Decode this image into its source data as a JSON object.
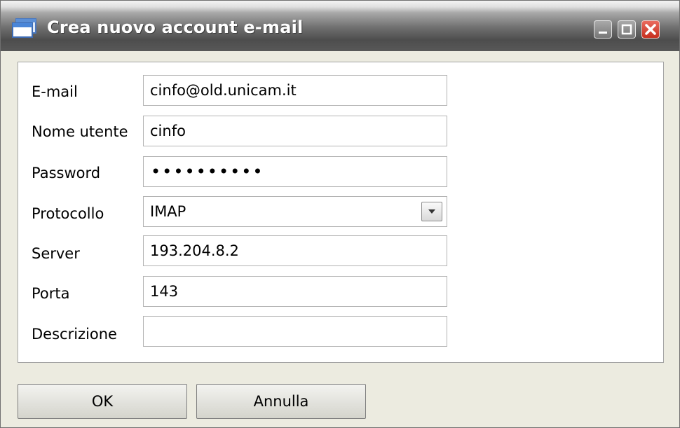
{
  "window": {
    "title": "Crea nuovo account e-mail",
    "controls": {
      "minimize_icon": "minimize-icon",
      "maximize_icon": "maximize-icon",
      "close_icon": "close-icon"
    }
  },
  "form": {
    "fields": [
      {
        "label": "E-mail",
        "value": "cinfo@old.unicam.it"
      },
      {
        "label": "Nome utente",
        "value": "cinfo"
      },
      {
        "label": "Password",
        "value": "••••••••••"
      },
      {
        "label": "Protocollo",
        "value": "IMAP"
      },
      {
        "label": "Server",
        "value": "193.204.8.2"
      },
      {
        "label": "Porta",
        "value": "143"
      },
      {
        "label": "Descrizione",
        "value": ""
      }
    ]
  },
  "buttons": {
    "ok": "OK",
    "cancel": "Annulla"
  },
  "colors": {
    "titlebar": "#5a5a5a",
    "close_button": "#d9402f",
    "window_bg": "#ecebe0"
  }
}
